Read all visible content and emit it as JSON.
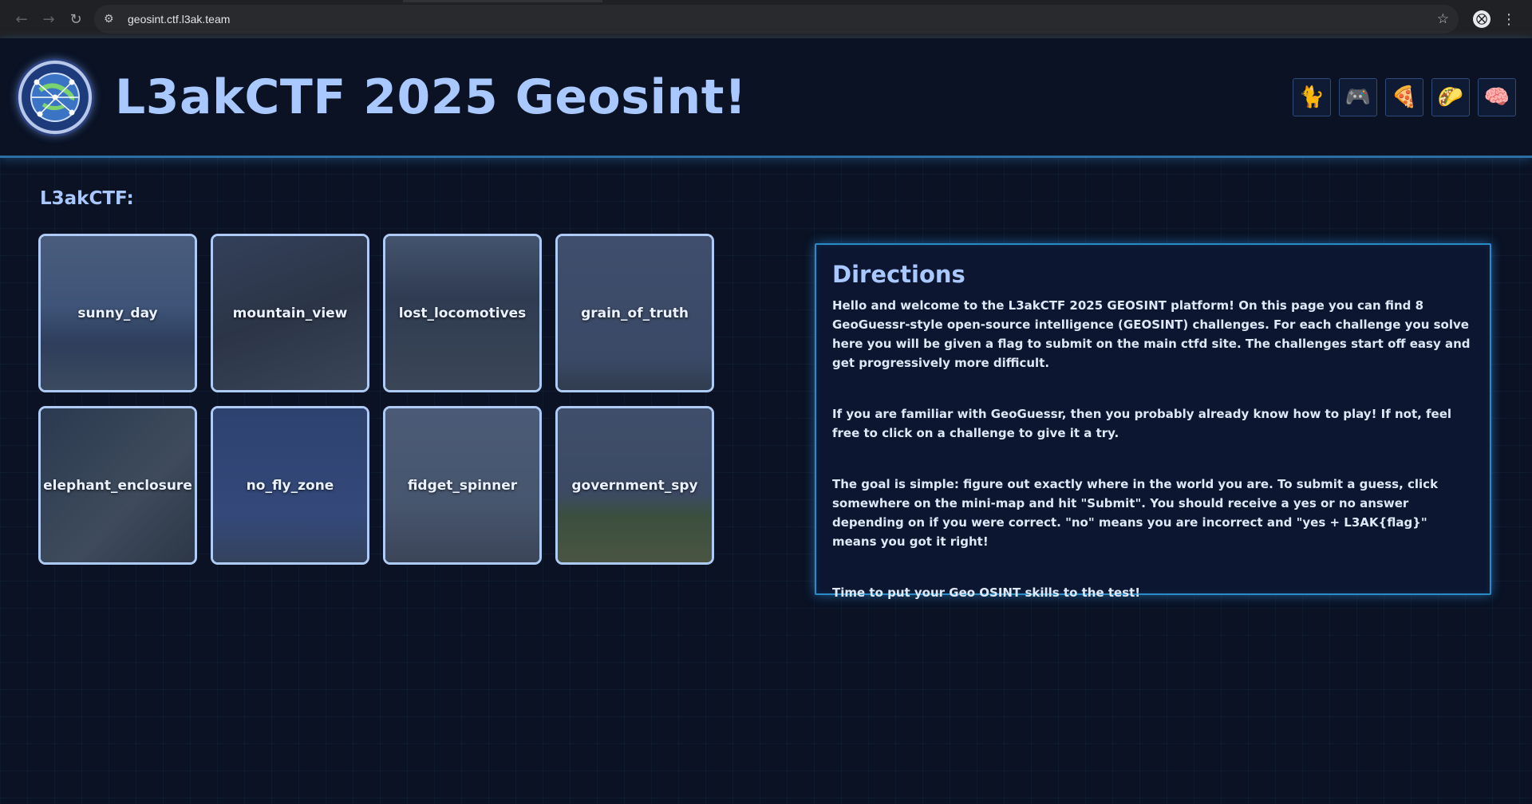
{
  "browser": {
    "url": "geosint.ctf.l3ak.team",
    "back_glyph": "←",
    "forward_glyph": "→",
    "reload_glyph": "↻",
    "site_info_glyph": "⚙",
    "star_glyph": "☆",
    "profile_glyph": "⛒",
    "menu_glyph": "⋮"
  },
  "header": {
    "title": "L3akCTF 2025 Geosint!",
    "icons": [
      {
        "name": "cat-icon",
        "glyph": "🐈"
      },
      {
        "name": "gamepad-icon",
        "glyph": "🎮"
      },
      {
        "name": "pizza-icon",
        "glyph": "🍕"
      },
      {
        "name": "taco-icon",
        "glyph": "🌮"
      },
      {
        "name": "brain-icon",
        "glyph": "🧠"
      }
    ]
  },
  "section": {
    "label": "L3akCTF:"
  },
  "challenges": [
    {
      "name": "sunny_day"
    },
    {
      "name": "mountain_view"
    },
    {
      "name": "lost_locomotives"
    },
    {
      "name": "grain_of_truth"
    },
    {
      "name": "elephant_enclosure"
    },
    {
      "name": "no_fly_zone"
    },
    {
      "name": "fidget_spinner"
    },
    {
      "name": "government_spy"
    }
  ],
  "directions": {
    "title": "Directions",
    "paragraphs": [
      "Hello and welcome to the L3akCTF 2025 GEOSINT platform! On this page you can find 8 GeoGuessr-style open-source intelligence (GEOSINT) challenges. For each challenge you solve here you will be given a flag to submit on the main ctfd site. The challenges start off easy and get progressively more difficult.",
      "If you are familiar with GeoGuessr, then you probably already know how to play! If not, feel free to click on a challenge to give it a try.",
      "The goal is simple: figure out exactly where in the world you are. To submit a guess, click somewhere on the mini-map and hit \"Submit\". You should receive a yes or no answer depending on if you were correct. \"no\" means you are incorrect and \"yes + L3AK{flag}\" means you got it right!",
      "Time to put your Geo OSINT skills to the test!"
    ]
  }
}
